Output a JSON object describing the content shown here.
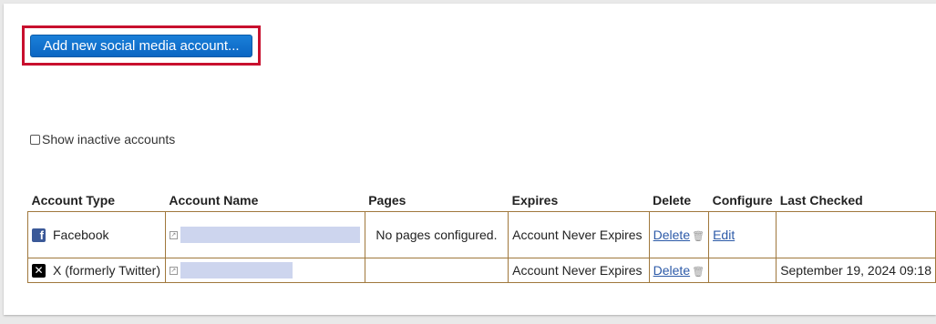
{
  "add_button": {
    "label": "Add new social media account..."
  },
  "inactive_toggle": {
    "label": "Show inactive accounts",
    "checked": false
  },
  "table": {
    "headers": [
      "Account Type",
      "Account Name",
      "Pages",
      "Expires",
      "Delete",
      "Configure",
      "Last Checked"
    ],
    "rows": [
      {
        "type": "Facebook",
        "icon": "facebook-icon",
        "pages": "No pages configured.",
        "expires": "Account Never Expires",
        "delete": "Delete",
        "configure": "Edit",
        "last_checked": ""
      },
      {
        "type": "X (formerly Twitter)",
        "icon": "x-icon",
        "pages": "",
        "expires": "Account Never Expires",
        "delete": "Delete",
        "configure": "",
        "last_checked": "September 19, 2024 09:18"
      }
    ]
  },
  "colors": {
    "highlight_border": "#c8102e",
    "button_bg": "#0b66c3",
    "table_border": "#a0783c",
    "link": "#2c5aa8",
    "redacted": "#cdd5ee"
  }
}
